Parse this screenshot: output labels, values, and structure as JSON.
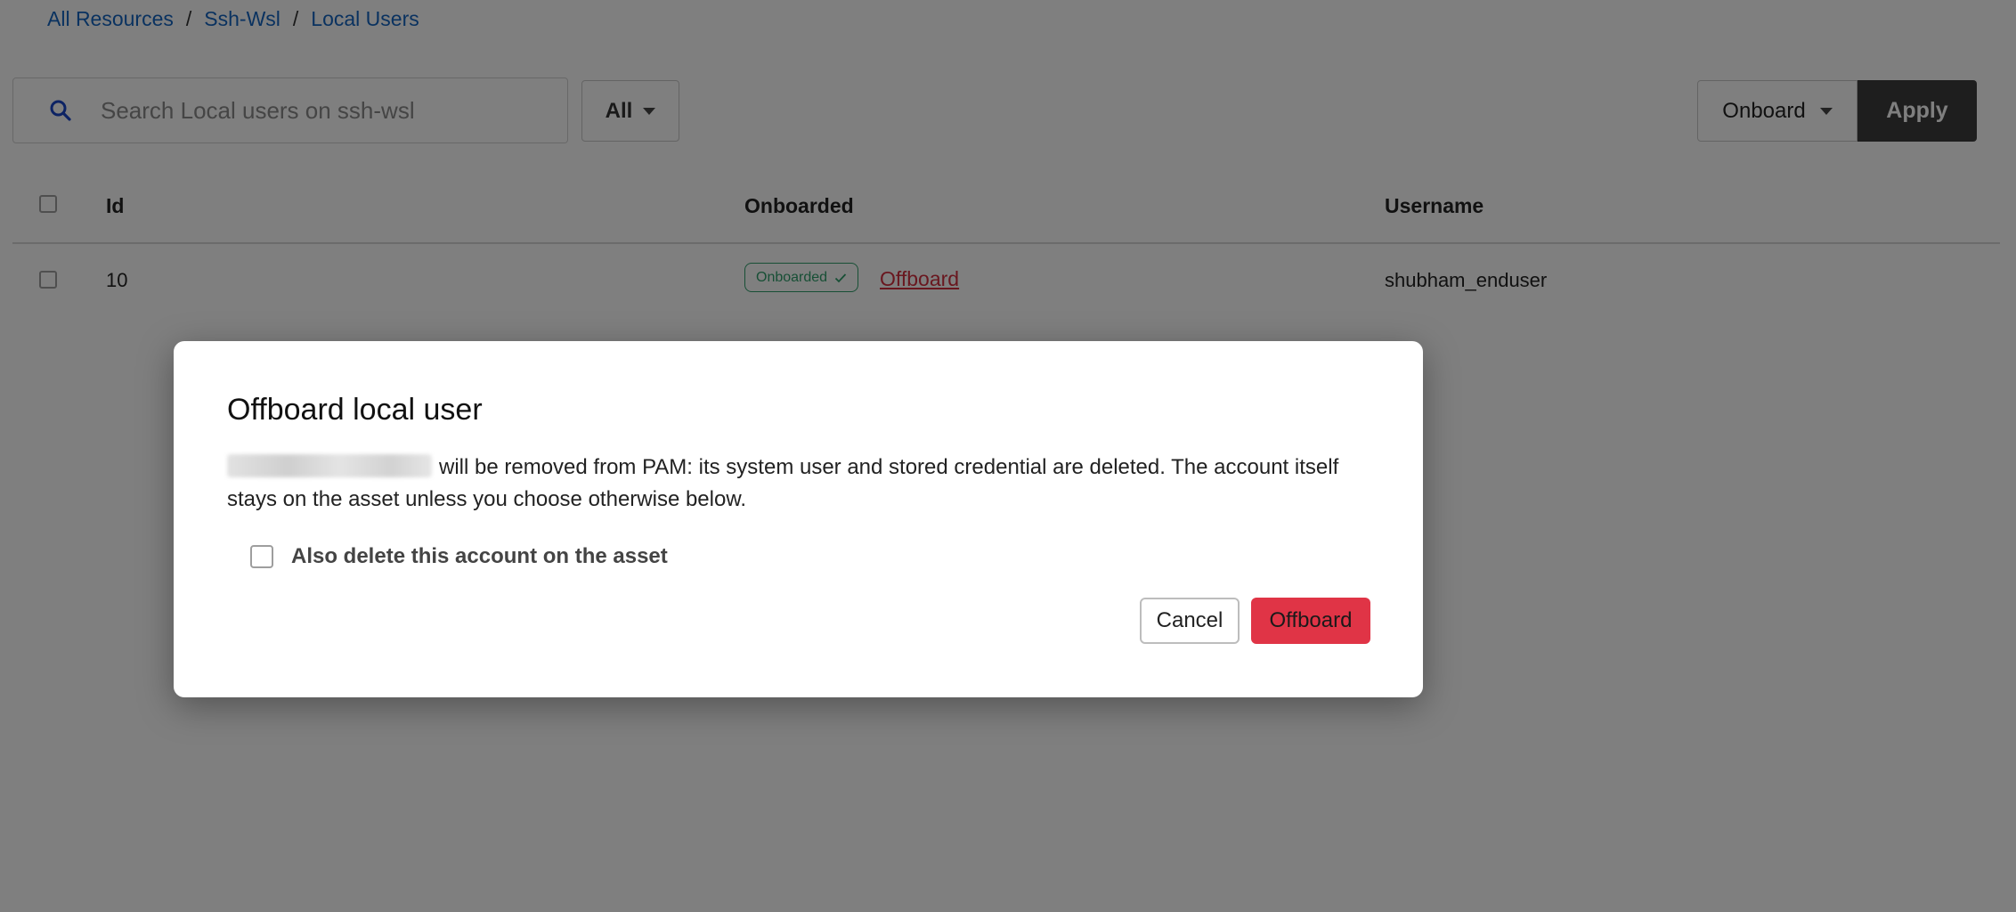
{
  "breadcrumb": {
    "items": [
      "All Resources",
      "Ssh-Wsl",
      "Local Users"
    ],
    "separator": "/"
  },
  "search": {
    "placeholder": "Search Local users on ssh-wsl",
    "value": "",
    "icon": "search-icon"
  },
  "filter": {
    "selected": "All"
  },
  "bulk_action": {
    "selected": "Onboard",
    "apply_label": "Apply"
  },
  "table": {
    "columns": [
      "Id",
      "Onboarded",
      "Username"
    ],
    "rows": [
      {
        "id": "10",
        "status_badge": "Onboarded",
        "action_link": "Offboard",
        "username": "shubham_enduser"
      }
    ]
  },
  "modal": {
    "title": "Offboard local user",
    "message": "will be removed from PAM: its system user and stored credential are deleted. The account itself stays on the asset unless you choose otherwise below.",
    "option_label": "Also delete this account on the asset",
    "option_checked": false,
    "cancel_label": "Cancel",
    "confirm_label": "Offboard"
  },
  "colors": {
    "link": "#1565c0",
    "danger": "#e03446",
    "success": "#2e9e6b",
    "apply_bg": "#3d3d3d"
  }
}
